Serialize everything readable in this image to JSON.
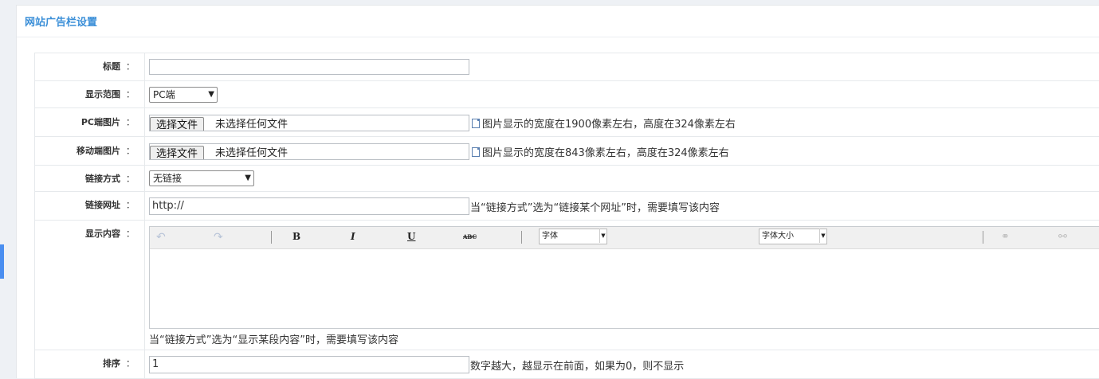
{
  "panel": {
    "title": "网站广告栏设置"
  },
  "form": {
    "title": {
      "label": "标题",
      "colon": "：",
      "value": ""
    },
    "scope": {
      "label": "显示范围",
      "colon": "：",
      "selected": "PC端"
    },
    "pc_image": {
      "label": "PC端图片",
      "colon": "：",
      "button": "选择文件",
      "status": "未选择任何文件",
      "hint": "图片显示的宽度在1900像素左右，高度在324像素左右"
    },
    "mobile_image": {
      "label": "移动端图片",
      "colon": "：",
      "button": "选择文件",
      "status": "未选择任何文件",
      "hint": "图片显示的宽度在843像素左右，高度在324像素左右"
    },
    "link_type": {
      "label": "链接方式",
      "colon": "：",
      "selected": "无链接"
    },
    "link_url": {
      "label": "链接网址",
      "colon": "：",
      "value": "http://",
      "hint": "当“链接方式”选为“链接某个网址”时，需要填写该内容"
    },
    "content": {
      "label": "显示内容",
      "colon": "：",
      "toolbar": {
        "undo_icon": "undo-icon",
        "redo_icon": "redo-icon",
        "bold": "B",
        "italic": "I",
        "underline": "U",
        "strike": "ABC",
        "font_select": "字体",
        "size_select": "字体大小",
        "link_icon": "link-icon",
        "unlink_icon": "unlink-icon"
      },
      "hint": "当“链接方式”选为“显示某段内容”时，需要填写该内容"
    },
    "order": {
      "label": "排序",
      "colon": "：",
      "value": "1",
      "hint": "数字越大，越显示在前面，如果为0，则不显示"
    }
  }
}
